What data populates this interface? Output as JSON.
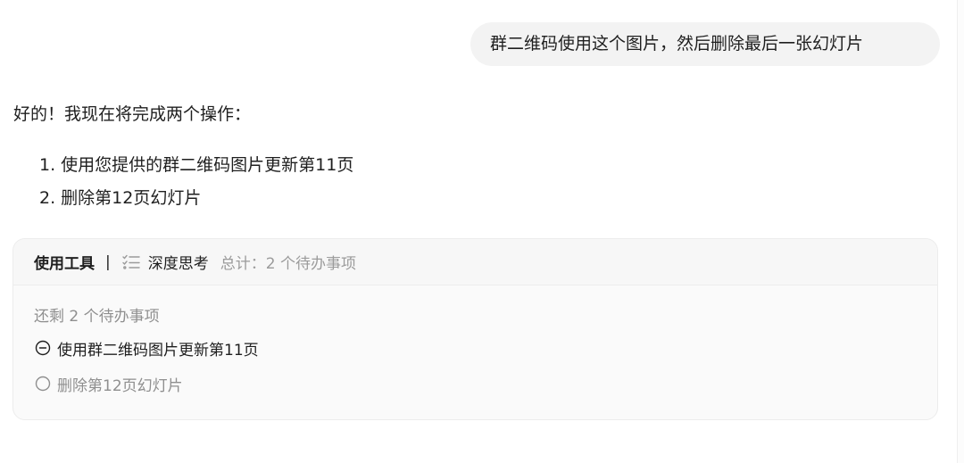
{
  "user_message": "群二维码使用这个图片，然后删除最后一张幻灯片",
  "assistant": {
    "intro": "好的！我现在将完成两个操作：",
    "steps": [
      "1. 使用您提供的群二维码图片更新第11页",
      "2. 删除第12页幻灯片"
    ]
  },
  "tool_card": {
    "title": "使用工具",
    "separator": "|",
    "icon": "list-icon",
    "mode": "深度思考",
    "total": "总计：2 个待办事项",
    "remaining": "还剩 2 个待办事项",
    "todos": [
      {
        "label": "使用群二维码图片更新第11页",
        "status": "in-progress",
        "icon": "minus-circle-icon"
      },
      {
        "label": "删除第12页幻灯片",
        "status": "pending",
        "icon": "empty-circle-icon"
      }
    ]
  },
  "colors": {
    "bubble": "#f3f3f3",
    "card_bg": "#fafafa",
    "muted_text": "#8f8f8f",
    "border": "#ececec"
  }
}
